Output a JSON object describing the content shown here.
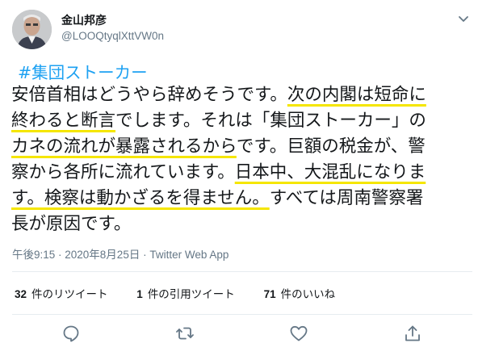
{
  "author": {
    "display_name": "金山邦彦",
    "handle": "@LOOQtyqlXttVW0n"
  },
  "tweet": {
    "hashtag": "#集団ストーカー",
    "lines": [
      {
        "a": "安倍首相はどうやら辞めそうです。",
        "b": "次の内閣は短命に",
        "c": ""
      },
      {
        "a": "",
        "b": "終わると断言",
        "c": "でします。それは「集団ストーカー」の"
      },
      {
        "a": "",
        "b": "カネの流れが暴露されるから",
        "c": "です。巨額の税金が、警"
      },
      {
        "a": "察から各所に流れています。",
        "b": "日本中、大混乱になりま",
        "c": ""
      },
      {
        "a": "",
        "b": "す。検察は動かざるを得ません。",
        "c": "すべては周南警察署"
      },
      {
        "a": "長が原因です。",
        "b": "",
        "c": ""
      }
    ],
    "timestamp": "午後9:15 · 2020年8月25日 · Twitter Web App"
  },
  "stats": {
    "retweets_count": "32",
    "retweets_label": "件のリツイート",
    "quotes_count": "1",
    "quotes_label": "件の引用ツイート",
    "likes_count": "71",
    "likes_label": "件のいいね"
  },
  "icons": {
    "caret": "chevron-down-icon",
    "reply": "reply-icon",
    "retweet": "retweet-icon",
    "like": "heart-icon",
    "share": "share-icon"
  },
  "colors": {
    "hashtag": "#1da1f2",
    "underline_highlight": "#f5e600",
    "secondary_text": "#657786"
  }
}
